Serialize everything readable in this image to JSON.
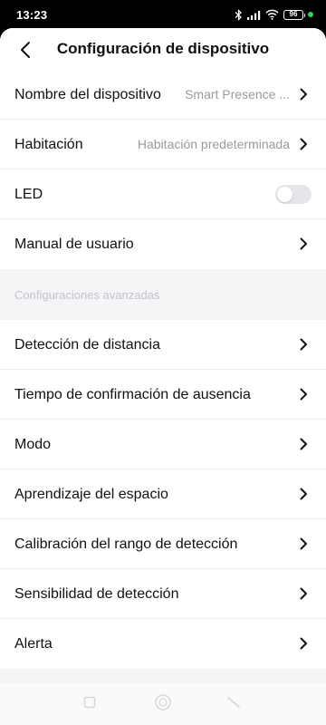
{
  "status": {
    "time": "13:23",
    "battery": "96"
  },
  "header": {
    "title": "Configuración de dispositivo"
  },
  "rows_top": [
    {
      "label": "Nombre del dispositivo",
      "value": "Smart Presence ..."
    },
    {
      "label": "Habitación",
      "value": "Habitación predeterminada"
    },
    {
      "label": "LED",
      "toggle_on": false
    },
    {
      "label": "Manual de usuario"
    }
  ],
  "advanced": {
    "section_title": "Configuraciones avanzadas",
    "items": [
      {
        "label": "Detección de distancia"
      },
      {
        "label": "Tiempo de confirmación de ausencia"
      },
      {
        "label": "Modo"
      },
      {
        "label": "Aprendizaje del espacio"
      },
      {
        "label": "Calibración del rango de detección"
      },
      {
        "label": "Sensibilidad de detección"
      },
      {
        "label": "Alerta"
      }
    ]
  },
  "colors": {
    "status_bar": "#000000",
    "background": "#f5f5f7",
    "row": "#ffffff",
    "toggle_off": "#e6e6ea",
    "section_text": "#c2c2c8"
  },
  "icons": [
    "bluetooth-icon",
    "signal-icon",
    "wifi-icon",
    "battery-icon",
    "back-arrow-icon",
    "chevron-right-icon",
    "nav-recents-icon",
    "nav-home-icon",
    "nav-back-icon"
  ]
}
